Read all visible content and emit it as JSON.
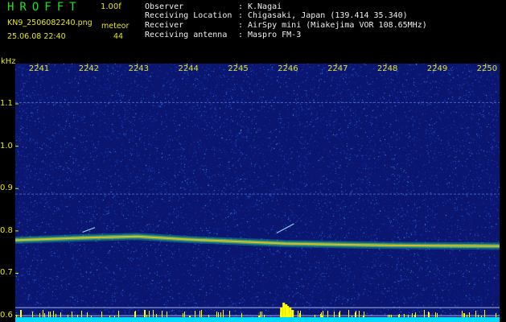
{
  "header": {
    "app_title": "HROFFT",
    "version": "1.00f",
    "filename": "KN9_2506082240.png",
    "datetime": "25.06.08 22:40",
    "mode": "meteor",
    "count": "44",
    "info": [
      {
        "label": "Observer",
        "value": "K.Nagai"
      },
      {
        "label": "Receiving Location",
        "value": "Chigasaki, Japan (139.414 35.340)"
      },
      {
        "label": "Receiver",
        "value": "AirSpy mini (Miakejima VOR 108.65MHz)"
      },
      {
        "label": "Receiving antenna",
        "value": "Maspro FM-3"
      }
    ],
    "separator": ":"
  },
  "colors": {
    "background": "#000000",
    "plot_background": "#0a1670",
    "title_green": "#19e619",
    "label_yellow": "#e6e619",
    "info_text": "#f0f0f0",
    "trace": "#e8c020",
    "baseline": "#00d8ff",
    "spikes": "#ffff00"
  },
  "chart_data": {
    "type": "heatmap",
    "y_unit": "kHz",
    "x_tick_labels": [
      "2241",
      "2242",
      "2243",
      "2244",
      "2245",
      "2246",
      "2247",
      "2248",
      "2249",
      "2250"
    ],
    "x_ticks": [
      2241,
      2242,
      2243,
      2244,
      2245,
      2246,
      2247,
      2248,
      2249,
      2250
    ],
    "x_range": [
      2240.55,
      2250.28
    ],
    "y_tick_labels": [
      "1.1",
      "1.0",
      "0.9",
      "0.8",
      "0.7",
      "0.6"
    ],
    "y_ticks": [
      1.1,
      1.0,
      0.9,
      0.8,
      0.7,
      0.6
    ],
    "y_range": [
      0.585,
      1.195
    ],
    "carrier_trace": [
      {
        "x": 2240.55,
        "y": 0.778
      },
      {
        "x": 2242.0,
        "y": 0.784
      },
      {
        "x": 2243.0,
        "y": 0.787
      },
      {
        "x": 2244.0,
        "y": 0.78
      },
      {
        "x": 2245.0,
        "y": 0.775
      },
      {
        "x": 2246.0,
        "y": 0.77
      },
      {
        "x": 2247.0,
        "y": 0.768
      },
      {
        "x": 2248.0,
        "y": 0.766
      },
      {
        "x": 2249.0,
        "y": 0.765
      },
      {
        "x": 2250.28,
        "y": 0.764
      }
    ],
    "meteor_echoes": [
      {
        "x_start": 2241.9,
        "x_end": 2242.15,
        "y_start": 0.797,
        "y_end": 0.808
      },
      {
        "x_start": 2245.8,
        "x_end": 2246.15,
        "y_start": 0.795,
        "y_end": 0.817
      }
    ],
    "horizontal_lines_khz": [
      1.103,
      0.887,
      0.619,
      0.6
    ]
  }
}
